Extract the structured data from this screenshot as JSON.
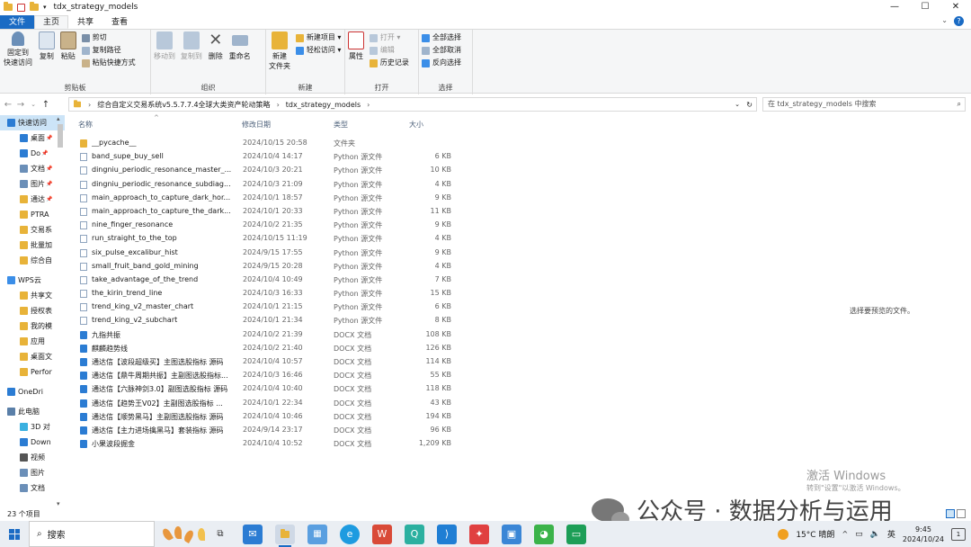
{
  "window": {
    "title": "tdx_strategy_models",
    "controls": [
      "—",
      "☐",
      "✕"
    ]
  },
  "tabs": [
    "文件",
    "主页",
    "共享",
    "查看"
  ],
  "ribbon": {
    "clipboard": {
      "label": "剪贴板",
      "pin": "固定到\n快速访问",
      "copy": "复制",
      "paste": "粘贴",
      "cut": "剪切",
      "copy_path": "复制路径",
      "paste_shortcut": "粘贴快捷方式"
    },
    "organize": {
      "label": "组织",
      "move_to": "移动到",
      "copy_to": "复制到",
      "delete": "删除",
      "rename": "重命名"
    },
    "new": {
      "label": "新建",
      "new_folder": "新建\n文件夹",
      "new_item": "新建项目 ▾",
      "easy_access": "轻松访问 ▾"
    },
    "open": {
      "label": "打开",
      "properties": "属性",
      "open": "打开 ▾",
      "edit": "编辑",
      "history": "历史记录"
    },
    "select": {
      "label": "选择",
      "select_all": "全部选择",
      "select_none": "全部取消",
      "invert": "反向选择"
    }
  },
  "address": {
    "path": [
      "综合自定义交易系统v5.5.7.7.4全球大类资产轮动策略",
      "tdx_strategy_models"
    ],
    "search_placeholder": "在 tdx_strategy_models 中搜索"
  },
  "nav_items": [
    {
      "label": "快速访问",
      "top": true,
      "selected": true,
      "color": "#2b7cd3"
    },
    {
      "label": "桌面",
      "pin": true,
      "color": "#2b7cd3"
    },
    {
      "label": "Do",
      "pin": true,
      "color": "#2b7cd3"
    },
    {
      "label": "文档",
      "pin": true,
      "color": "#6b8fb8"
    },
    {
      "label": "图片",
      "pin": true,
      "color": "#6b8fb8"
    },
    {
      "label": "通达",
      "pin": true,
      "color": "#e8b339"
    },
    {
      "label": "PTRA",
      "color": "#e8b339"
    },
    {
      "label": "交易系",
      "color": "#e8b339"
    },
    {
      "label": "批量加",
      "color": "#e8b339"
    },
    {
      "label": "综合自",
      "color": "#e8b339"
    },
    {
      "label": "WPS云",
      "top": true,
      "color": "#3b8ee8"
    },
    {
      "label": "共享文",
      "color": "#e8b339"
    },
    {
      "label": "授权表",
      "color": "#e8b339"
    },
    {
      "label": "我的模",
      "color": "#e8b339"
    },
    {
      "label": "应用",
      "color": "#e8b339"
    },
    {
      "label": "桌面文",
      "color": "#e8b339"
    },
    {
      "label": "Perfor",
      "color": "#e8b339"
    },
    {
      "label": "OneDri",
      "top": true,
      "color": "#2b7cd3"
    },
    {
      "label": "此电脑",
      "top": true,
      "color": "#5a7fa8"
    },
    {
      "label": "3D 对",
      "color": "#3ab0e0"
    },
    {
      "label": "Down",
      "color": "#2b7cd3"
    },
    {
      "label": "视频",
      "color": "#555"
    },
    {
      "label": "图片",
      "color": "#6b8fb8"
    },
    {
      "label": "文档",
      "color": "#6b8fb8"
    }
  ],
  "columns": {
    "name": "名称",
    "date": "修改日期",
    "type": "类型",
    "size": "大小"
  },
  "files": [
    {
      "name": "__pycache__",
      "date": "2024/10/15 20:58",
      "type": "文件夹",
      "size": "",
      "kind": "folder"
    },
    {
      "name": "band_supe_buy_sell",
      "date": "2024/10/4 14:17",
      "type": "Python 源文件",
      "size": "6 KB",
      "kind": "py"
    },
    {
      "name": "dingniu_periodic_resonance_master_...",
      "date": "2024/10/3 20:21",
      "type": "Python 源文件",
      "size": "10 KB",
      "kind": "py"
    },
    {
      "name": "dingniu_periodic_resonance_subdiag...",
      "date": "2024/10/3 21:09",
      "type": "Python 源文件",
      "size": "4 KB",
      "kind": "py"
    },
    {
      "name": "main_approach_to_capture_dark_hor...",
      "date": "2024/10/1 18:57",
      "type": "Python 源文件",
      "size": "9 KB",
      "kind": "py"
    },
    {
      "name": "main_approach_to_capture_the_dark...",
      "date": "2024/10/1 20:33",
      "type": "Python 源文件",
      "size": "11 KB",
      "kind": "py"
    },
    {
      "name": "nine_finger_resonance",
      "date": "2024/10/2 21:35",
      "type": "Python 源文件",
      "size": "9 KB",
      "kind": "py"
    },
    {
      "name": "run_straight_to_the_top",
      "date": "2024/10/15 11:19",
      "type": "Python 源文件",
      "size": "4 KB",
      "kind": "py"
    },
    {
      "name": "six_pulse_excalibur_hist",
      "date": "2024/9/15 17:55",
      "type": "Python 源文件",
      "size": "9 KB",
      "kind": "py"
    },
    {
      "name": "small_fruit_band_gold_mining",
      "date": "2024/9/15 20:28",
      "type": "Python 源文件",
      "size": "4 KB",
      "kind": "py"
    },
    {
      "name": "take_advantage_of_the_trend",
      "date": "2024/10/4 10:49",
      "type": "Python 源文件",
      "size": "7 KB",
      "kind": "py"
    },
    {
      "name": "the_kirin_trend_line",
      "date": "2024/10/3 16:33",
      "type": "Python 源文件",
      "size": "15 KB",
      "kind": "py"
    },
    {
      "name": "trend_king_v2_master_chart",
      "date": "2024/10/1 21:15",
      "type": "Python 源文件",
      "size": "6 KB",
      "kind": "py"
    },
    {
      "name": "trend_king_v2_subchart",
      "date": "2024/10/1 21:34",
      "type": "Python 源文件",
      "size": "8 KB",
      "kind": "py"
    },
    {
      "name": "九指共振",
      "date": "2024/10/2 21:39",
      "type": "DOCX 文档",
      "size": "108 KB",
      "kind": "docx"
    },
    {
      "name": "麒麟趋势线",
      "date": "2024/10/2 21:40",
      "type": "DOCX 文档",
      "size": "126 KB",
      "kind": "docx"
    },
    {
      "name": "通达信【波段超级买】主图选股指标 源码",
      "date": "2024/10/4 10:57",
      "type": "DOCX 文档",
      "size": "114 KB",
      "kind": "docx"
    },
    {
      "name": "通达信【鼎牛周期共振】主副图选股指标...",
      "date": "2024/10/3 16:46",
      "type": "DOCX 文档",
      "size": "55 KB",
      "kind": "docx"
    },
    {
      "name": "通达信【六脉神剑3.0】副图选股指标 源码",
      "date": "2024/10/4 10:40",
      "type": "DOCX 文档",
      "size": "118 KB",
      "kind": "docx"
    },
    {
      "name": "通达信【趋势王V02】主副图选股指标 ...",
      "date": "2024/10/1 22:34",
      "type": "DOCX 文档",
      "size": "43 KB",
      "kind": "docx"
    },
    {
      "name": "通达信【顺势黑马】主副图选股指标 源码",
      "date": "2024/10/4 10:46",
      "type": "DOCX 文档",
      "size": "194 KB",
      "kind": "docx"
    },
    {
      "name": "通达信【主力进场擒黑马】套装指标 源码",
      "date": "2024/9/14 23:17",
      "type": "DOCX 文档",
      "size": "96 KB",
      "kind": "docx"
    },
    {
      "name": "小果波段掘金",
      "date": "2024/10/4 10:52",
      "type": "DOCX 文档",
      "size": "1,209 KB",
      "kind": "docx"
    }
  ],
  "preview_text": "选择要预览的文件。",
  "status": {
    "count": "23 个项目"
  },
  "watermark": {
    "title": "激活 Windows",
    "sub": "转到\"设置\"以激活 Windows。"
  },
  "wechat_caption": "公众号 · 数据分析与运用",
  "taskbar": {
    "search": "搜索",
    "weather": "15°C 晴朗",
    "ime": "英",
    "time": "9:45",
    "date": "2024/10/24",
    "notifications": "1"
  }
}
